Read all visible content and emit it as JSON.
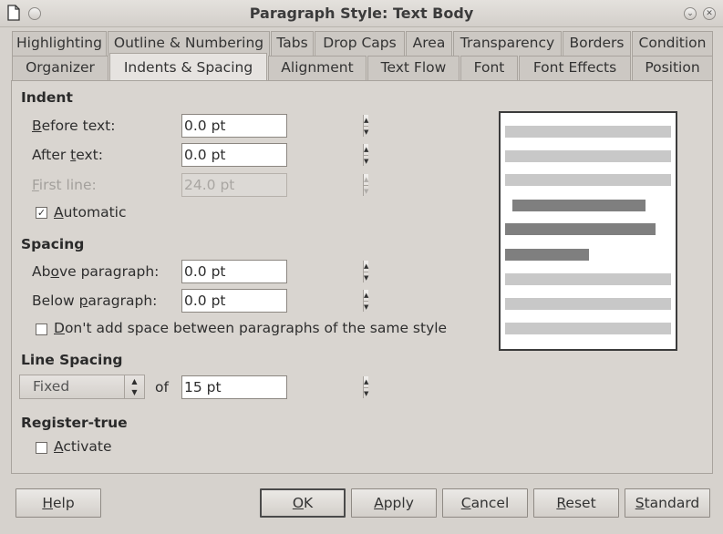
{
  "window": {
    "title": "Paragraph Style: Text Body",
    "minimize_glyph": "⌄",
    "close_glyph": "✕"
  },
  "tabs_row1": [
    "Highlighting",
    "Outline & Numbering",
    "Tabs",
    "Drop Caps",
    "Area",
    "Transparency",
    "Borders",
    "Condition"
  ],
  "tabs_row2": [
    "Organizer",
    "Indents & Spacing",
    "Alignment",
    "Text Flow",
    "Font",
    "Font Effects",
    "Position"
  ],
  "active_tab": "Indents & Spacing",
  "indent": {
    "title": "Indent",
    "before_text": {
      "mnemonic": "B",
      "rest": "efore text:",
      "value": "0.0 pt"
    },
    "after_text": {
      "before": "After ",
      "mnemonic": "t",
      "rest": "ext:",
      "value": "0.0 pt"
    },
    "first_line": {
      "mnemonic": "F",
      "rest": "irst line:",
      "value": "24.0 pt",
      "disabled": true
    },
    "automatic": {
      "mnemonic": "A",
      "rest": "utomatic",
      "checked": true
    }
  },
  "spacing": {
    "title": "Spacing",
    "above_paragraph": {
      "before": "Ab",
      "mnemonic": "o",
      "rest": "ve paragraph:",
      "value": "0.0 pt"
    },
    "below_paragraph": {
      "before": "Below ",
      "mnemonic": "p",
      "rest": "aragraph:",
      "value": "0.0 pt"
    },
    "dont_add_space": {
      "mnemonic": "D",
      "rest": "on't add space between paragraphs of the same style",
      "checked": false
    }
  },
  "line_spacing": {
    "title": "Line Spacing",
    "selected": "Fixed",
    "of_label": "of",
    "value": "15 pt"
  },
  "register_true": {
    "title": "Register-true",
    "activate": {
      "mnemonic": "A",
      "rest": "ctivate",
      "checked": false
    }
  },
  "buttons": {
    "help": {
      "mnemonic": "H",
      "rest": "elp"
    },
    "ok": {
      "mnemonic": "O",
      "rest": "K"
    },
    "apply": {
      "mnemonic": "A",
      "rest": "pply"
    },
    "cancel": {
      "mnemonic": "C",
      "rest": "ancel"
    },
    "reset": {
      "mnemonic": "R",
      "rest": "eset"
    },
    "standard": {
      "mnemonic": "S",
      "rest": "tandard"
    }
  },
  "colors": {
    "preview_light_line": "#c8c8c8",
    "preview_dark_line": "#7f7f7f"
  }
}
